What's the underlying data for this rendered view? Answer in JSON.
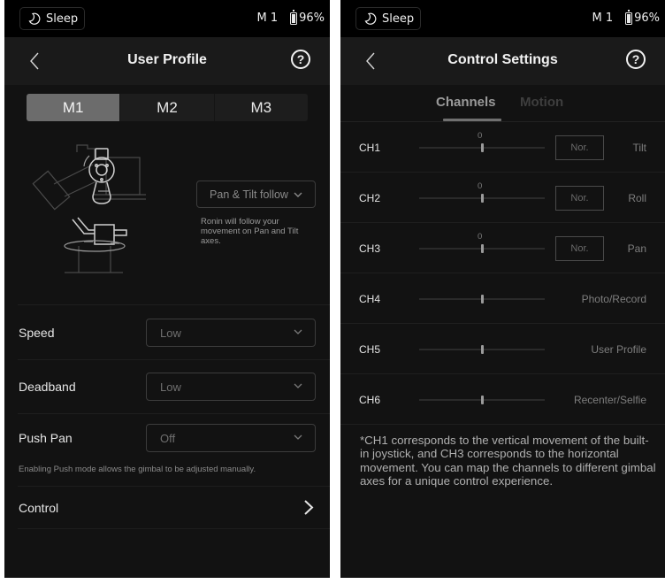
{
  "status_bar": {
    "sleep_label": "Sleep",
    "mode": "M 1",
    "battery": "96%"
  },
  "user_profile": {
    "title": "User Profile",
    "profiles": [
      {
        "label": "M1",
        "active": true
      },
      {
        "label": "M2",
        "active": false
      },
      {
        "label": "M3",
        "active": false
      }
    ],
    "follow_mode": "Pan & Tilt follow",
    "follow_description": "Ronin will follow your movement on Pan and Tilt axes.",
    "settings": [
      {
        "label": "Speed",
        "value": "Low"
      },
      {
        "label": "Deadband",
        "value": "Low"
      },
      {
        "label": "Push Pan",
        "value": "Off"
      }
    ],
    "push_note": "Enabling Push mode allows the gimbal to be adjusted manually.",
    "control_label": "Control"
  },
  "control_settings": {
    "title": "Control Settings",
    "tabs": [
      {
        "label": "Channels",
        "active": true
      },
      {
        "label": "Motion",
        "active": false
      }
    ],
    "channels": [
      {
        "name": "CH1",
        "value": "0",
        "slider_position": 0.5,
        "mode": "Nor.",
        "function": "Tilt"
      },
      {
        "name": "CH2",
        "value": "0",
        "slider_position": 0.5,
        "mode": "Nor.",
        "function": "Roll"
      },
      {
        "name": "CH3",
        "value": "0",
        "slider_position": 0.5,
        "mode": "Nor.",
        "function": "Pan"
      },
      {
        "name": "CH4",
        "value": null,
        "slider_position": 0.5,
        "mode": null,
        "function": "Photo/Record"
      },
      {
        "name": "CH5",
        "value": null,
        "slider_position": 0.5,
        "mode": null,
        "function": "User Profile"
      },
      {
        "name": "CH6",
        "value": null,
        "slider_position": 0.5,
        "mode": null,
        "function": "Recenter/Selfie"
      }
    ],
    "note": "*CH1 corresponds to the vertical movement of the built-in joystick, and CH3 corresponds to the horizontal movement. You can map the channels to different gimbal axes for a unique control experience."
  },
  "icons": {
    "sleep": "moon-icon",
    "battery": "battery-icon",
    "back": "chevron-left-icon",
    "help": "question-circle-icon",
    "dropdown": "chevron-down-icon",
    "forward": "chevron-right-icon"
  }
}
